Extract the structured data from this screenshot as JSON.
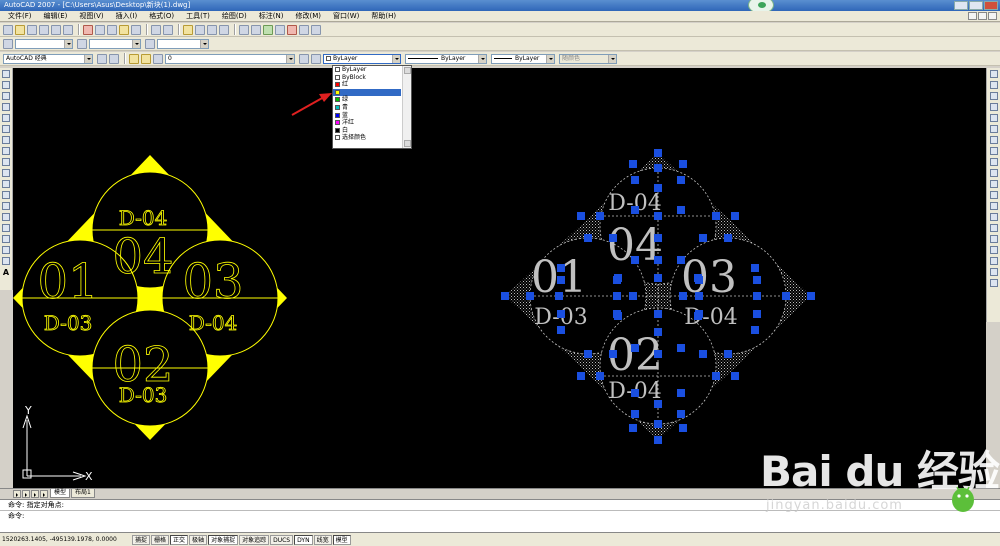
{
  "window": {
    "title": "AutoCAD 2007 - [C:\\Users\\Asus\\Desktop\\新块(1).dwg]"
  },
  "menubar": {
    "items": [
      "文件(F)",
      "编辑(E)",
      "视图(V)",
      "插入(I)",
      "格式(O)",
      "工具(T)",
      "绘图(D)",
      "标注(N)",
      "修改(M)",
      "窗口(W)",
      "帮助(H)"
    ]
  },
  "toolbar_workspace": {
    "workspace_value": "AutoCAD 经典",
    "layer_value": "0"
  },
  "properties": {
    "color_value": "ByLayer",
    "linetype_value": "ByLayer",
    "lineweight_value": "ByLayer",
    "plotstyle_value": "随颜色"
  },
  "color_dropdown": {
    "options": [
      {
        "label": "ByLayer",
        "color": "#ffffff"
      },
      {
        "label": "ByBlock",
        "color": "#ffffff"
      },
      {
        "label": "红",
        "color": "#ff0000"
      },
      {
        "label": "",
        "color": "#ffff00",
        "highlighted": true
      },
      {
        "label": "绿",
        "color": "#00c000"
      },
      {
        "label": "青",
        "color": "#00c0c0"
      },
      {
        "label": "蓝",
        "color": "#0000ff"
      },
      {
        "label": "洋红",
        "color": "#ff00ff"
      },
      {
        "label": "白",
        "color": "#000000"
      },
      {
        "label": "选择颜色",
        "color": "#ffffff"
      }
    ]
  },
  "drawing": {
    "left_block": {
      "color": "#ffff00",
      "circles": [
        {
          "big": "04",
          "small": "D-04"
        },
        {
          "big": "01",
          "small": "D-03"
        },
        {
          "big": "03",
          "small": "D-04"
        },
        {
          "big": "02",
          "small": "D-03"
        }
      ]
    },
    "right_block": {
      "color": "#c0c0c0",
      "grip_color": "#1a4fe0",
      "circles": [
        {
          "big": "04",
          "small": "D-04"
        },
        {
          "big": "01",
          "small": "D-03"
        },
        {
          "big": "03",
          "small": "D-04"
        },
        {
          "big": "02",
          "small": "D-04"
        }
      ]
    },
    "ucs": {
      "x_label": "X",
      "y_label": "Y"
    },
    "annotation_arrow_color": "#e02020"
  },
  "tabs": {
    "items": [
      "模型",
      "布局1"
    ]
  },
  "command": {
    "history_line": "命令: 指定对角点:",
    "prompt": "命令:"
  },
  "statusbar": {
    "coords": "1520263.1405, -495139.1978, 0.0000",
    "buttons": [
      {
        "label": "捕捉",
        "on": false
      },
      {
        "label": "栅格",
        "on": false
      },
      {
        "label": "正交",
        "on": true
      },
      {
        "label": "极轴",
        "on": false
      },
      {
        "label": "对象捕捉",
        "on": true
      },
      {
        "label": "对象追踪",
        "on": false
      },
      {
        "label": "DUCS",
        "on": false
      },
      {
        "label": "DYN",
        "on": true
      },
      {
        "label": "线宽",
        "on": false
      },
      {
        "label": "模型",
        "on": true
      }
    ]
  },
  "watermark": {
    "logo": "Bai du 经验",
    "url": "jingyan.baidu.com"
  }
}
